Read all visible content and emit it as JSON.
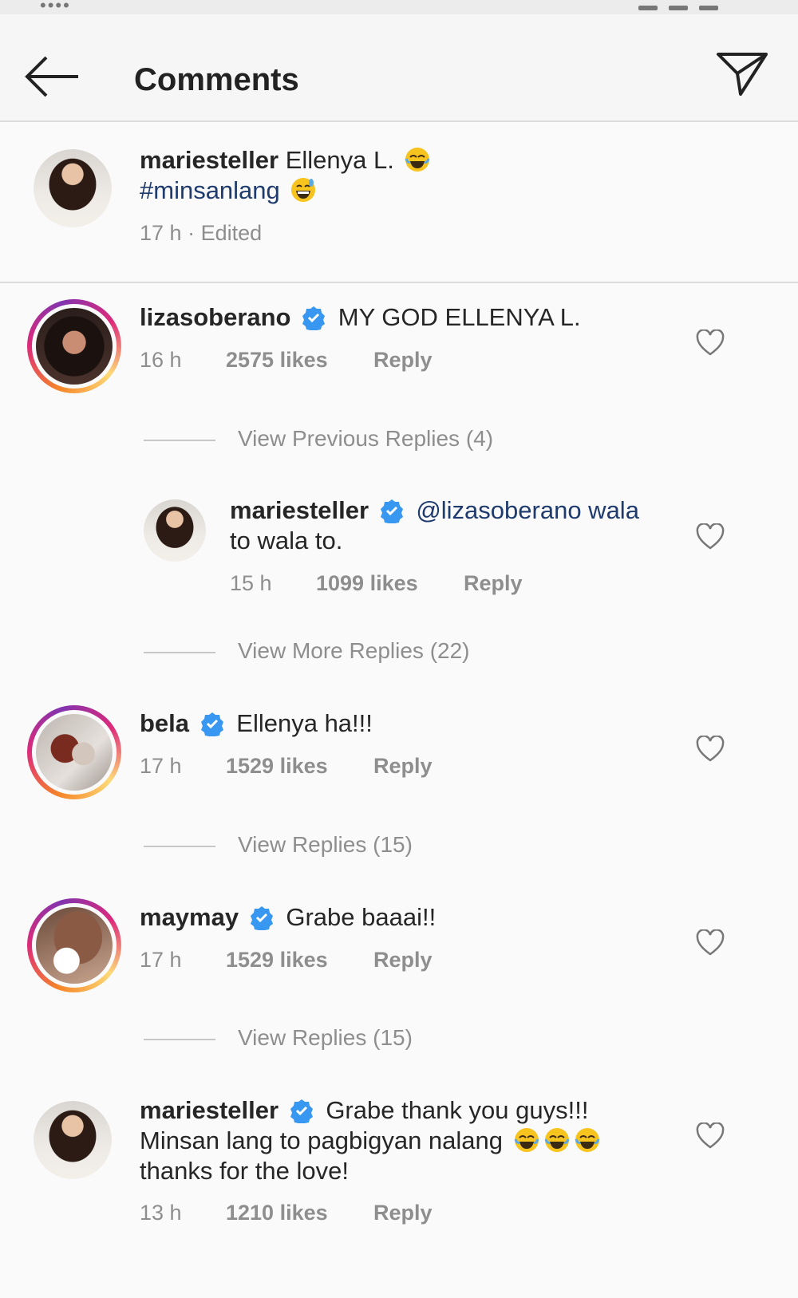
{
  "header": {
    "title": "Comments"
  },
  "caption": {
    "username": "mariesteller",
    "text_line1": "Ellenya L.",
    "text_line2": "#minsanlang",
    "time": "17 h",
    "separator": "·",
    "edited": "Edited"
  },
  "comments": [
    {
      "username": "lizasoberano",
      "text": "MY GOD ELLENYA L.",
      "time": "16 h",
      "likes": "2575 likes",
      "reply": "Reply",
      "verified": true
    },
    {
      "username": "mariesteller",
      "text_line1": "@lizasoberano wala",
      "text_line2": "to wala to.",
      "time": "15 h",
      "likes": "1099 likes",
      "reply": "Reply",
      "verified": true
    },
    {
      "username": "bela",
      "text": "Ellenya ha!!!",
      "time": "17 h",
      "likes": "1529 likes",
      "reply": "Reply",
      "verified": true
    },
    {
      "username": "maymay",
      "text": "Grabe baaai!!",
      "time": "17 h",
      "likes": "1529 likes",
      "reply": "Reply",
      "verified": true
    },
    {
      "username": "mariesteller",
      "text_line1": "Grabe thank you guys!!!",
      "text_line2": "Minsan lang to pagbigyan nalang",
      "text_line3": "thanks for the love!",
      "time": "13 h",
      "likes": "1210 likes",
      "reply": "Reply",
      "verified": true
    }
  ],
  "reply_links": [
    "View Previous Replies (4)",
    "View More Replies (22)",
    "View Replies (15)",
    "View Replies (15)"
  ],
  "icons": {
    "back": "arrow-left-icon",
    "send": "paper-plane-icon",
    "heart": "heart-outline-icon",
    "verified": "verified-badge-icon",
    "emoji_laugh": "tears-of-joy-emoji",
    "emoji_sweat": "grinning-sweat-emoji"
  },
  "colors": {
    "verified": "#3897f0",
    "hashtag": "#1f3b6e",
    "meta": "#8e8e8e"
  }
}
